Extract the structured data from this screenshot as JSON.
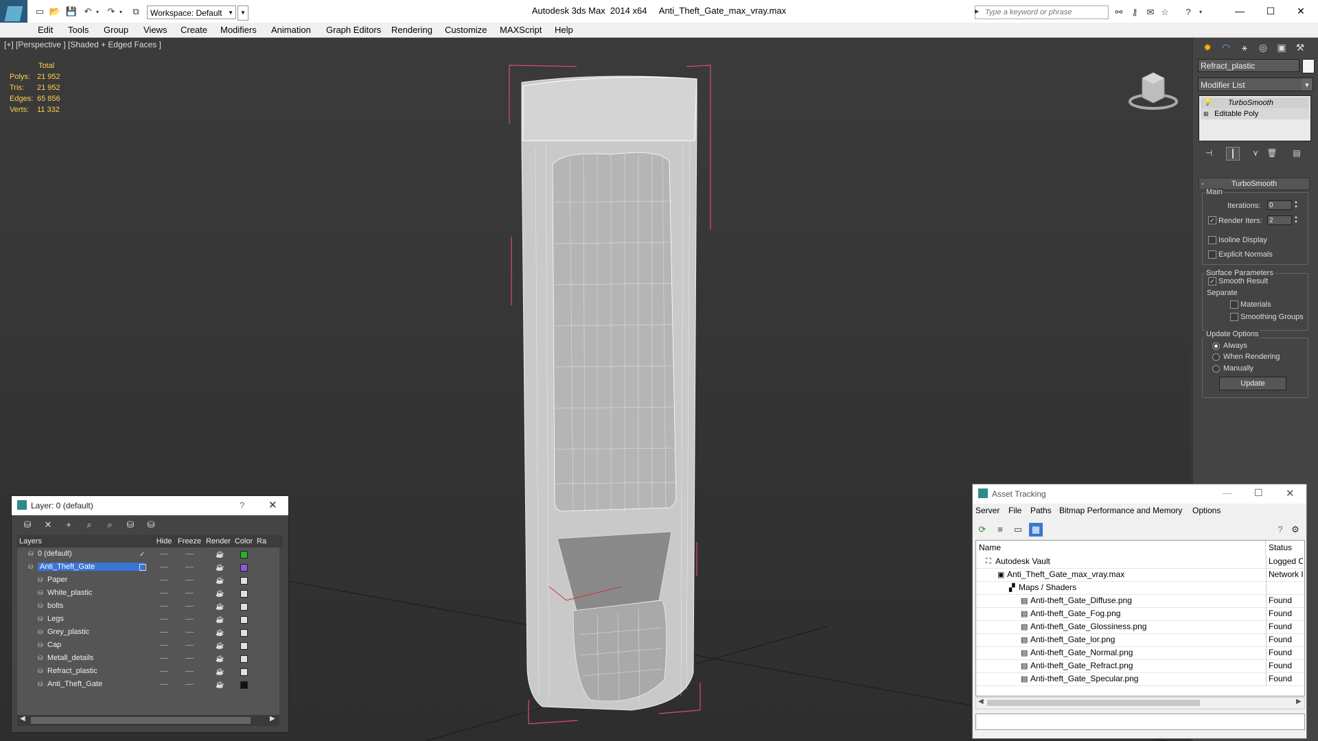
{
  "titlebar": {
    "workspace": "Workspace: Default",
    "app_title": "Autodesk 3ds Max  2014 x64     Anti_Theft_Gate_max_vray.max",
    "search_placeholder": "Type a keyword or phrase"
  },
  "menu": [
    "Edit",
    "Tools",
    "Group",
    "Views",
    "Create",
    "Modifiers",
    "Animation",
    "Graph Editors",
    "Rendering",
    "Customize",
    "MAXScript",
    "Help"
  ],
  "viewport": {
    "label": "[+] [Perspective ] [Shaded + Edged Faces ]",
    "stats": {
      "header": "Total",
      "rows": [
        {
          "label": "Polys:",
          "value": "21 952"
        },
        {
          "label": "Tris:",
          "value": "21 952"
        },
        {
          "label": "Edges:",
          "value": "65 856"
        },
        {
          "label": "Verts:",
          "value": "11 332"
        }
      ]
    }
  },
  "command_panel": {
    "object_name": "Refract_plastic",
    "modifier_list": "Modifier List",
    "stack": [
      "TurboSmooth",
      "Editable Poly"
    ],
    "rollout_title": "TurboSmooth",
    "main_group": "Main",
    "iterations_label": "Iterations:",
    "iterations_value": "0",
    "render_iters_label": "Render Iters:",
    "render_iters_value": "2",
    "isoline_label": "Isoline Display",
    "explicit_normals_label": "Explicit Normals",
    "surface_group": "Surface Parameters",
    "smooth_result_label": "Smooth Result",
    "separate_label": "Separate",
    "materials_label": "Materials",
    "smoothing_groups_label": "Smoothing Groups",
    "update_group": "Update Options",
    "always_label": "Always",
    "when_rendering_label": "When Rendering",
    "manually_label": "Manually",
    "update_button": "Update"
  },
  "layer_window": {
    "title": "Layer: 0 (default)",
    "help": "?",
    "columns": [
      "Layers",
      "Hide",
      "Freeze",
      "Render",
      "Color",
      "Ra"
    ],
    "rows": [
      {
        "name": "0 (default)",
        "indent": 0,
        "color": "#2bb02b",
        "check": true
      },
      {
        "name": "Anti_Theft_Gate",
        "indent": 0,
        "color": "#8a5ae0",
        "selected": true
      },
      {
        "name": "Paper",
        "indent": 1,
        "color": "#e0e0e0"
      },
      {
        "name": "White_plastic",
        "indent": 1,
        "color": "#e0e0e0"
      },
      {
        "name": "bolts",
        "indent": 1,
        "color": "#e0e0e0"
      },
      {
        "name": "Legs",
        "indent": 1,
        "color": "#e0e0e0"
      },
      {
        "name": "Grey_plastic",
        "indent": 1,
        "color": "#e0e0e0"
      },
      {
        "name": "Cap",
        "indent": 1,
        "color": "#e0e0e0"
      },
      {
        "name": "Metall_details",
        "indent": 1,
        "color": "#e0e0e0"
      },
      {
        "name": "Refract_plastic",
        "indent": 1,
        "color": "#e0e0e0"
      },
      {
        "name": "Anti_Theft_Gate",
        "indent": 1,
        "color": "#111111"
      }
    ]
  },
  "asset_window": {
    "title": "Asset Tracking",
    "menu": [
      "Server",
      "File",
      "Paths",
      "Bitmap Performance and Memory",
      "Options"
    ],
    "columns": [
      "Name",
      "Status"
    ],
    "rows": [
      {
        "name": "Autodesk Vault",
        "indent": 1,
        "status": "Logged O"
      },
      {
        "name": "Anti_Theft_Gate_max_vray.max",
        "indent": 2,
        "status": "Network I"
      },
      {
        "name": "Maps / Shaders",
        "indent": 3,
        "status": ""
      },
      {
        "name": "Anti-theft_Gate_Diffuse.png",
        "indent": 4,
        "status": "Found"
      },
      {
        "name": "Anti-theft_Gate_Fog.png",
        "indent": 4,
        "status": "Found"
      },
      {
        "name": "Anti-theft_Gate_Glossiness.png",
        "indent": 4,
        "status": "Found"
      },
      {
        "name": "Anti-theft_Gate_lor.png",
        "indent": 4,
        "status": "Found"
      },
      {
        "name": "Anti-theft_Gate_Normal.png",
        "indent": 4,
        "status": "Found"
      },
      {
        "name": "Anti-theft_Gate_Refract.png",
        "indent": 4,
        "status": "Found"
      },
      {
        "name": "Anti-theft_Gate_Specular.png",
        "indent": 4,
        "status": "Found"
      }
    ]
  }
}
